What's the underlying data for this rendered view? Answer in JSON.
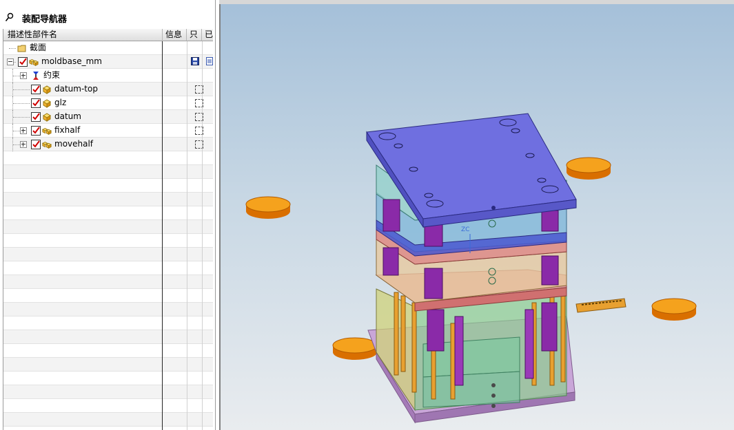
{
  "navigator": {
    "title": "装配导航器",
    "columns": [
      "描述性部件名",
      "信息",
      "只",
      "已"
    ],
    "rows": [
      {
        "label": "截面",
        "type": "folder",
        "depth": 0
      },
      {
        "label": "moldbase_mm",
        "type": "assembly",
        "depth": 0,
        "expand": "minus",
        "checked": true
      },
      {
        "label": "约束",
        "type": "constraints",
        "depth": 1,
        "expand": "plus"
      },
      {
        "label": "datum-top",
        "type": "part",
        "depth": 1,
        "checked": true
      },
      {
        "label": "glz",
        "type": "part",
        "depth": 1,
        "checked": true
      },
      {
        "label": "datum",
        "type": "part",
        "depth": 1,
        "checked": true
      },
      {
        "label": "fixhalf",
        "type": "assembly",
        "depth": 1,
        "expand": "plus",
        "checked": true
      },
      {
        "label": "movehalf",
        "type": "assembly",
        "depth": 1,
        "expand": "plus",
        "checked": true
      }
    ]
  },
  "viewport": {
    "axis_label": "ZC",
    "colors": {
      "background_top": "#a5c0d9",
      "plate_top": "#6f6fe0",
      "disc": "#f5a21d"
    }
  }
}
